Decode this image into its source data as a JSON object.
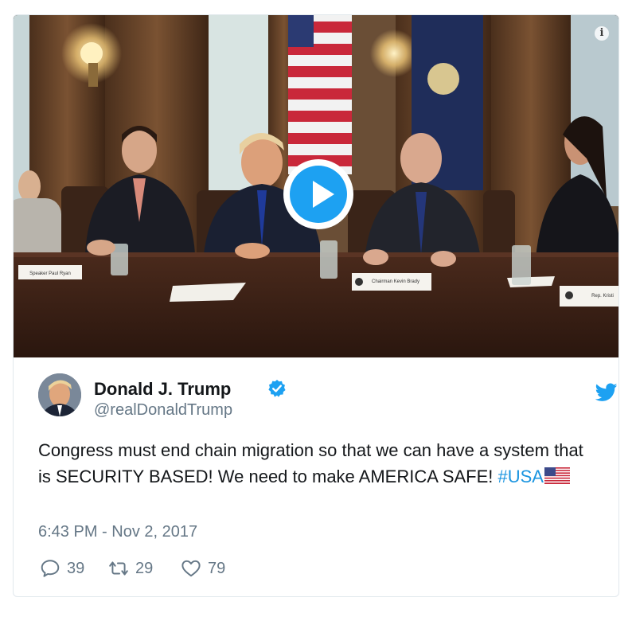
{
  "media": {
    "info_icon": "info-icon",
    "play_icon": "play-icon",
    "placards": [
      "Speaker Paul Ryan",
      "Chairman Kevin Brady",
      "Rep. Kristi"
    ]
  },
  "author": {
    "name": "Donald J. Trump",
    "handle": "@realDonaldTrump",
    "verified_icon": "verified-badge-icon",
    "platform_icon": "twitter-bird-icon"
  },
  "tweet": {
    "text_main": "Congress must end chain migration so that we can have a system that is SECURITY BASED! We need to make AMERICA SAFE! ",
    "hashtag": "#USA",
    "emoji_icon": "us-flag-icon",
    "timestamp": "6:43 PM - Nov 2, 2017"
  },
  "actions": {
    "replies": "39",
    "retweets": "29",
    "likes": "79"
  },
  "colors": {
    "accent": "#1da1f2",
    "hashtag": "#1b95e0",
    "text": "#14171a",
    "muted": "#657786",
    "border": "#e1e8ed"
  }
}
